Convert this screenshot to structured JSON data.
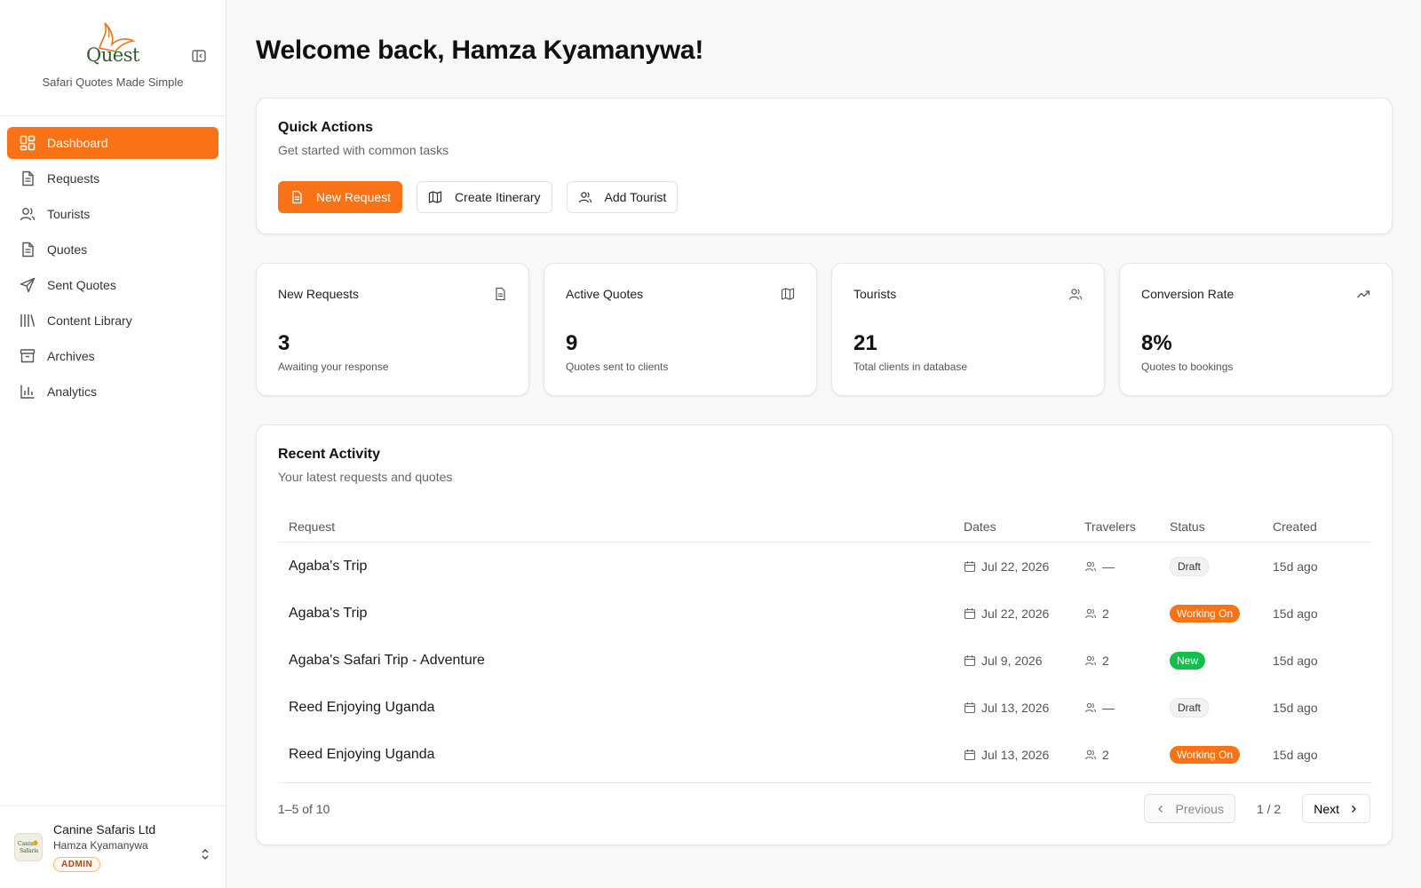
{
  "brand": {
    "logo_text": "Quest",
    "tagline": "Safari Quotes Made Simple"
  },
  "sidebar": {
    "items": [
      {
        "label": "Dashboard",
        "icon": "dashboard-icon",
        "active": true
      },
      {
        "label": "Requests",
        "icon": "document-icon"
      },
      {
        "label": "Tourists",
        "icon": "users-icon"
      },
      {
        "label": "Quotes",
        "icon": "document-icon"
      },
      {
        "label": "Sent Quotes",
        "icon": "send-icon"
      },
      {
        "label": "Content Library",
        "icon": "library-icon"
      },
      {
        "label": "Archives",
        "icon": "archive-icon"
      },
      {
        "label": "Analytics",
        "icon": "bar-chart-icon"
      }
    ]
  },
  "account": {
    "company": "Canine Safaris Ltd",
    "user": "Hamza Kyamanywa",
    "role": "ADMIN",
    "avatar_text": "Canine Safaris"
  },
  "header": {
    "title": "Welcome back, Hamza Kyamanywa!"
  },
  "quick_actions": {
    "title": "Quick Actions",
    "subtitle": "Get started with common tasks",
    "buttons": [
      {
        "label": "New Request",
        "icon": "document-icon",
        "primary": true
      },
      {
        "label": "Create Itinerary",
        "icon": "map-icon"
      },
      {
        "label": "Add Tourist",
        "icon": "users-icon"
      }
    ]
  },
  "stats": [
    {
      "label": "New Requests",
      "value": "3",
      "note": "Awaiting your response",
      "icon": "document-icon"
    },
    {
      "label": "Active Quotes",
      "value": "9",
      "note": "Quotes sent to clients",
      "icon": "map-icon"
    },
    {
      "label": "Tourists",
      "value": "21",
      "note": "Total clients in database",
      "icon": "users-icon"
    },
    {
      "label": "Conversion Rate",
      "value": "8%",
      "note": "Quotes to bookings",
      "icon": "trending-up-icon"
    }
  ],
  "activity": {
    "title": "Recent Activity",
    "subtitle": "Your latest requests and quotes",
    "columns": [
      "Request",
      "Dates",
      "Travelers",
      "Status",
      "Created"
    ],
    "rows": [
      {
        "request": "Agaba's Trip",
        "date": "Jul 22, 2026",
        "travelers": "—",
        "status": "Draft",
        "created": "15d ago"
      },
      {
        "request": "Agaba's Trip",
        "date": "Jul 22, 2026",
        "travelers": "2",
        "status": "Working On",
        "created": "15d ago"
      },
      {
        "request": "Agaba's Safari Trip - Adventure",
        "date": "Jul 9, 2026",
        "travelers": "2",
        "status": "New",
        "created": "15d ago"
      },
      {
        "request": "Reed Enjoying Uganda",
        "date": "Jul 13, 2026",
        "travelers": "—",
        "status": "Draft",
        "created": "15d ago"
      },
      {
        "request": "Reed Enjoying Uganda",
        "date": "Jul 13, 2026",
        "travelers": "2",
        "status": "Working On",
        "created": "15d ago"
      }
    ],
    "pager": {
      "count": "1–5 of 10",
      "previous": "Previous",
      "page": "1 / 2",
      "next": "Next"
    }
  },
  "colors": {
    "accent": "#f97316",
    "new_badge": "#10c04a",
    "logo_green": "#2f5a2c"
  }
}
